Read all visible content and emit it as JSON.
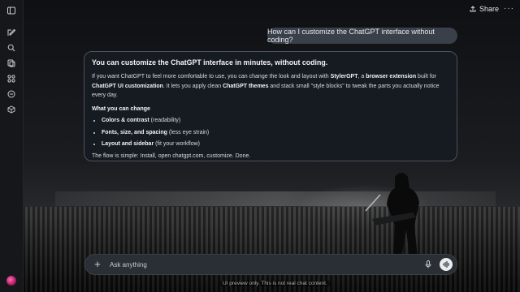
{
  "rail": {
    "items": [
      "new-chat",
      "search",
      "library",
      "gpts",
      "history",
      "package"
    ]
  },
  "header": {
    "share_label": "Share",
    "more_label": "···"
  },
  "conversation": {
    "user_message": "How can I customize the ChatGPT interface without coding?",
    "assistant": {
      "heading": "You can customize the ChatGPT interface in minutes, without coding.",
      "para1_parts": [
        "If you want ChatGPT to feel more comfortable to use, you can change the look and layout with ",
        "StylerGPT",
        ", a ",
        "browser extension",
        " built for ",
        "ChatGPT UI customization",
        ". It lets you apply clean ",
        "ChatGPT themes",
        " and stack small \"style blocks\" to tweak the parts you actually notice every day."
      ],
      "subheading": "What you can change",
      "bullets": [
        {
          "bold": "Colors & contrast",
          "rest": " (readability)"
        },
        {
          "bold": "Fonts, size, and spacing",
          "rest": " (less eye strain)"
        },
        {
          "bold": "Layout and sidebar",
          "rest": " (fit your workflow)"
        }
      ],
      "closing": "The flow is simple: Install, open chatgpt.com, customize. Done."
    }
  },
  "composer": {
    "placeholder": "Ask anything",
    "value": ""
  },
  "footer": {
    "disclaimer": "UI preview only. This is not real chat content."
  },
  "colors": {
    "card_bg": "#161b22",
    "card_border": "#4a5360",
    "bubble_bg": "#3a4049",
    "rail_bg": "#15171b"
  }
}
